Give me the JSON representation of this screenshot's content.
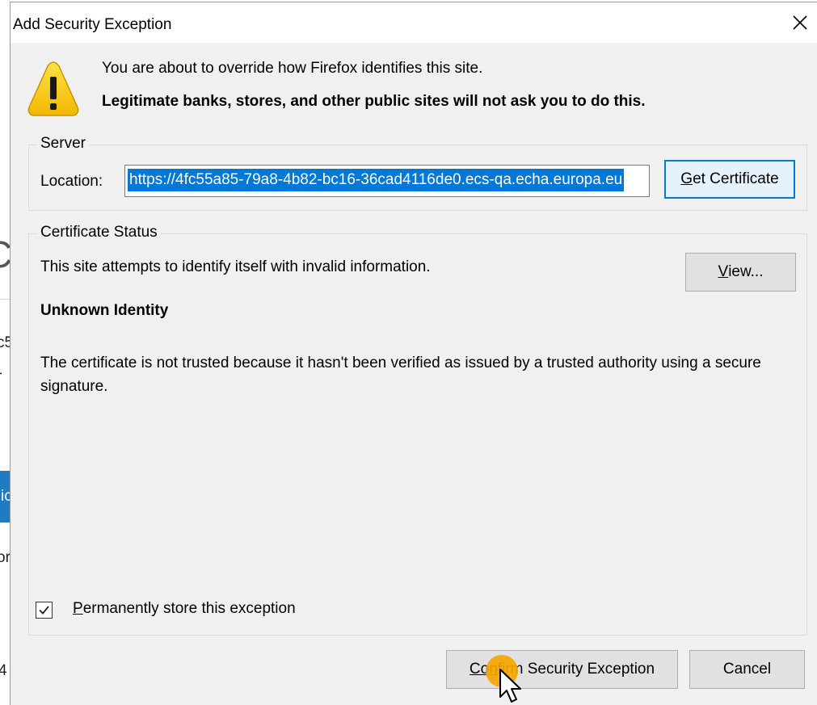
{
  "background": {
    "fragments": [
      "C",
      "c5",
      "r",
      "ic",
      "or",
      "4"
    ]
  },
  "dialog": {
    "title": "Add Security Exception",
    "close_icon": "close-icon",
    "warning_icon": "warning-triangle-icon",
    "intro_text": "You are about to override how Firefox identifies this site.",
    "warning_text": "Legitimate banks, stores, and other public sites will not ask you to do this."
  },
  "server": {
    "legend": "Server",
    "location_label": "Location:",
    "location_value": "https://4fc55a85-79a8-4b82-bc16-36cad4116de0.ecs-qa.echa.europa.eu",
    "get_certificate_label_u": "G",
    "get_certificate_label_rest": "et Certificate"
  },
  "certificate_status": {
    "legend": "Certificate Status",
    "status_text": "This site attempts to identify itself with invalid information.",
    "view_button_u": "V",
    "view_button_rest": "iew...",
    "identity_heading": "Unknown Identity",
    "explanation": "The certificate is not trusted because it hasn't been verified as issued by a trusted authority using a secure signature.",
    "permanent_checkbox_checked": true,
    "permanent_label_u": "P",
    "permanent_label_rest": "ermanently store this exception"
  },
  "buttons": {
    "confirm_u": "Con",
    "confirm_rest": "firm Security Exception",
    "cancel": "Cancel"
  },
  "colors": {
    "accent": "#0078d7",
    "dialog_bg": "#f0f0f0",
    "cursor_highlight": "#f5a600"
  }
}
